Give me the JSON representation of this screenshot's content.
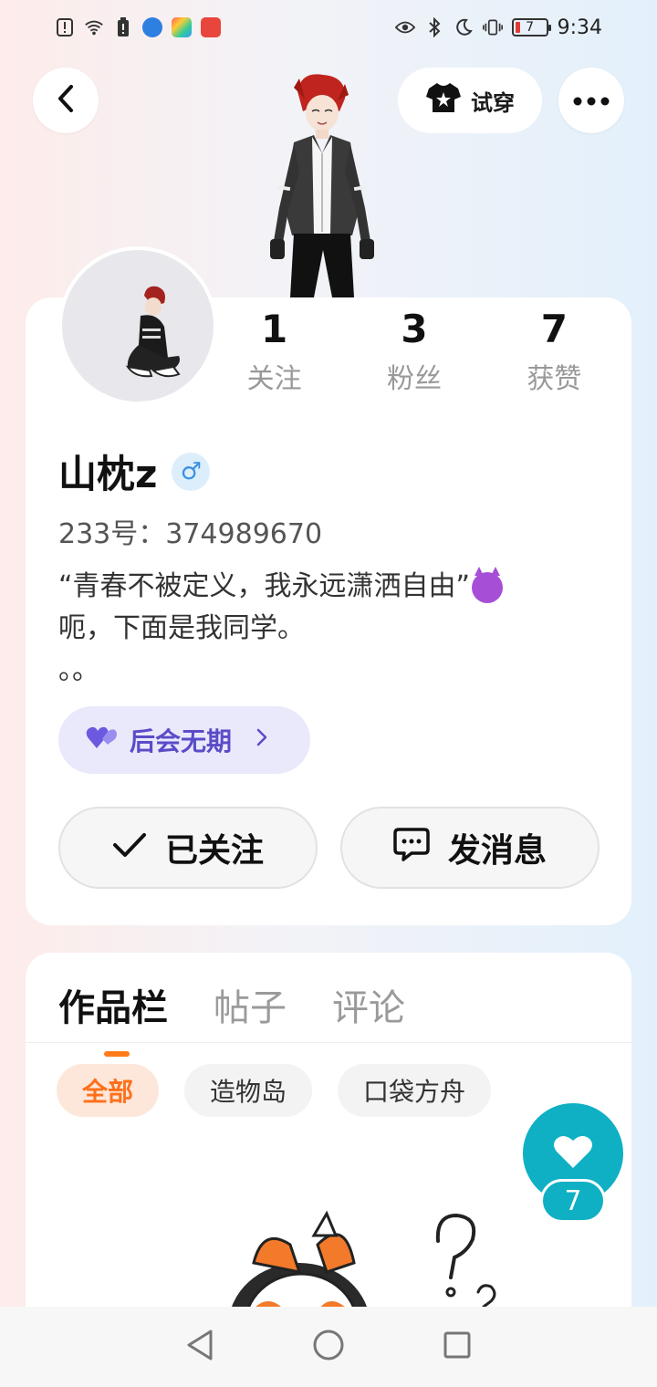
{
  "status_bar": {
    "time": "9:34",
    "battery_level": "7",
    "left_icons": [
      "alert-icon",
      "wifi-icon",
      "battery-warning-icon",
      "app-icon-blue",
      "app-icon-multicolor",
      "app-icon-red"
    ],
    "right_icons": [
      "eye-icon",
      "bluetooth-icon",
      "moon-icon",
      "vibrate-icon"
    ]
  },
  "header": {
    "try_on_label": "试穿"
  },
  "profile": {
    "stats": [
      {
        "value": "1",
        "label": "关注"
      },
      {
        "value": "3",
        "label": "粉丝"
      },
      {
        "value": "7",
        "label": "获赞"
      }
    ],
    "username": "山枕z",
    "gender_symbol": "♂",
    "uid": "233号：374989670",
    "bio_lines": [
      "“青春不被定义，我永远潇洒自由”",
      "呃，下面是我同学。",
      "。。"
    ],
    "badge_label": "后会无期",
    "follow_label": "已关注",
    "message_label": "发消息"
  },
  "content": {
    "tabs": [
      {
        "label": "作品栏",
        "active": true
      },
      {
        "label": "帖子",
        "active": false
      },
      {
        "label": "评论",
        "active": false
      }
    ],
    "chips": [
      {
        "label": "全部",
        "active": true
      },
      {
        "label": "造物岛",
        "active": false
      },
      {
        "label": "口袋方舟",
        "active": false
      }
    ]
  },
  "like_fab": {
    "count": "7"
  },
  "colors": {
    "accent_orange": "#ff7a1a",
    "badge_purple": "#5a4cc8",
    "fab_teal": "#0fb0c4"
  }
}
